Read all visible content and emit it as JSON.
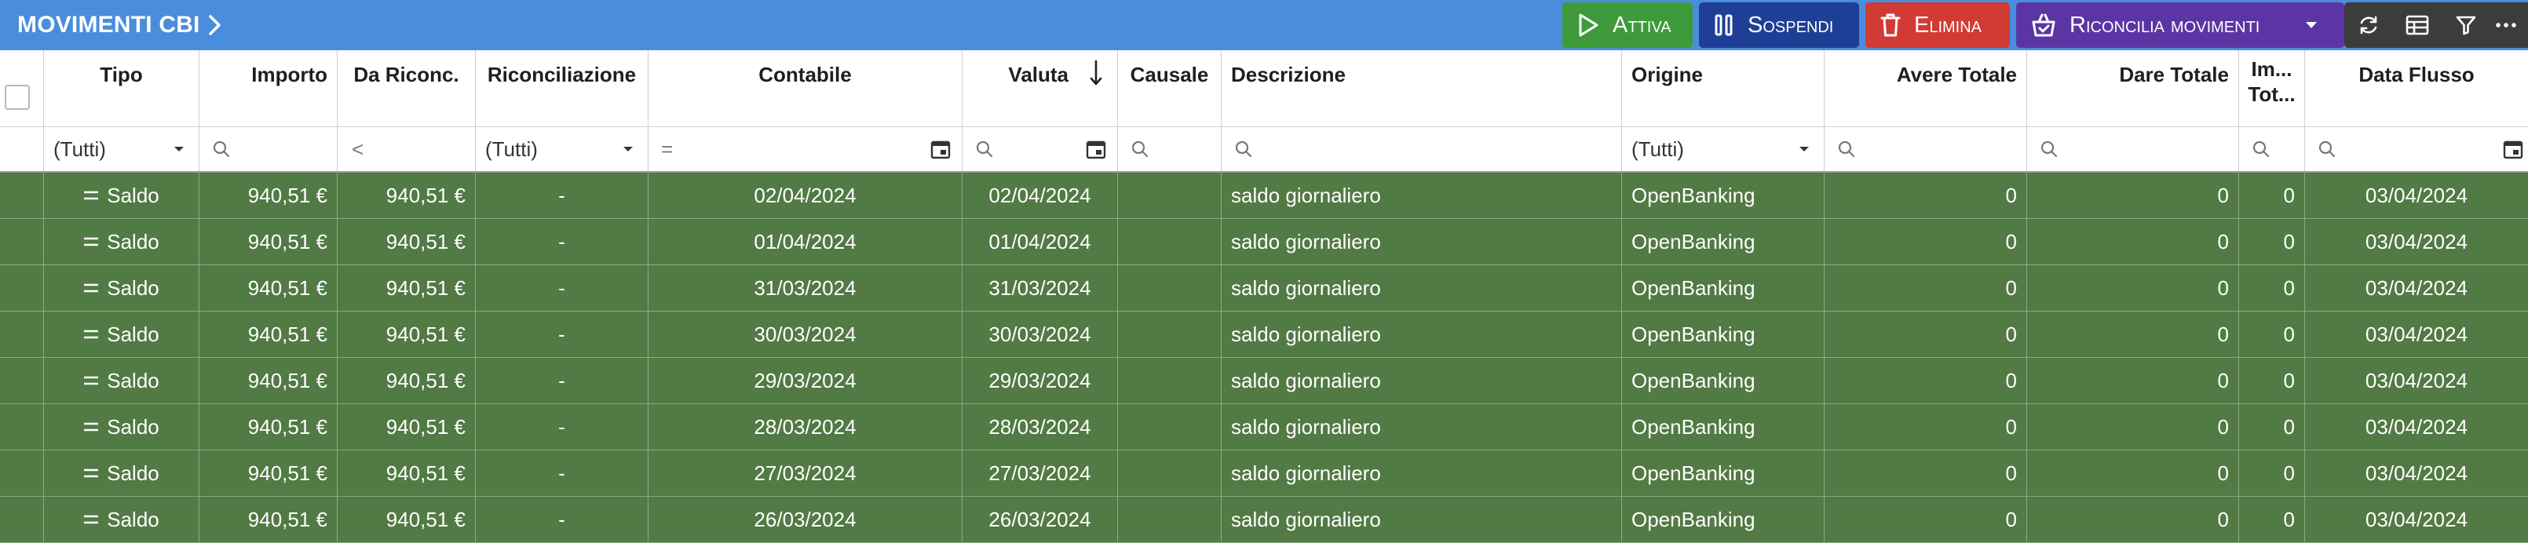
{
  "header": {
    "title": "MOVIMENTI CBI",
    "actions": {
      "attiva": "Attiva",
      "sospendi": "Sospendi",
      "elimina": "Elimina",
      "riconcilia": "Riconcilia movimenti"
    },
    "icons": [
      "play-icon",
      "pause-icon",
      "trash-icon",
      "basket-icon",
      "refresh-icon",
      "grid-icon",
      "filter-icon",
      "more-icon"
    ]
  },
  "colors": {
    "topbar": "#4a8ddc",
    "attiva": "#3e9a3a",
    "sospendi": "#1e3f95",
    "elimina": "#d23a34",
    "riconcilia": "#5b35a3",
    "row": "#527a44"
  },
  "table": {
    "columns": {
      "tipo": "Tipo",
      "importo": "Importo",
      "da_riconc": "Da Riconc.",
      "riconciliazione": "Riconciliazione",
      "contabile": "Contabile",
      "valuta": "Valuta",
      "causale": "Causale",
      "descrizione": "Descrizione",
      "origine": "Origine",
      "avere_totale": "Avere Totale",
      "dare_totale": "Dare Totale",
      "im_tot_line1": "Im...",
      "im_tot_line2": "Tot...",
      "data_flusso": "Data Flusso"
    },
    "filters": {
      "tipo": "(Tutti)",
      "da_riconc_op": "<",
      "riconciliazione": "(Tutti)",
      "contabile_op": "=",
      "origine": "(Tutti)"
    },
    "rows": [
      {
        "tipo": "Saldo",
        "importo": "940,51 €",
        "da_riconc": "940,51 €",
        "riconciliazione": "-",
        "contabile": "02/04/2024",
        "valuta": "02/04/2024",
        "causale": "",
        "descrizione": "saldo giornaliero",
        "origine": "OpenBanking",
        "avere_totale": "0",
        "dare_totale": "0",
        "im_tot": "0",
        "data_flusso": "03/04/2024"
      },
      {
        "tipo": "Saldo",
        "importo": "940,51 €",
        "da_riconc": "940,51 €",
        "riconciliazione": "-",
        "contabile": "01/04/2024",
        "valuta": "01/04/2024",
        "causale": "",
        "descrizione": "saldo giornaliero",
        "origine": "OpenBanking",
        "avere_totale": "0",
        "dare_totale": "0",
        "im_tot": "0",
        "data_flusso": "03/04/2024"
      },
      {
        "tipo": "Saldo",
        "importo": "940,51 €",
        "da_riconc": "940,51 €",
        "riconciliazione": "-",
        "contabile": "31/03/2024",
        "valuta": "31/03/2024",
        "causale": "",
        "descrizione": "saldo giornaliero",
        "origine": "OpenBanking",
        "avere_totale": "0",
        "dare_totale": "0",
        "im_tot": "0",
        "data_flusso": "03/04/2024"
      },
      {
        "tipo": "Saldo",
        "importo": "940,51 €",
        "da_riconc": "940,51 €",
        "riconciliazione": "-",
        "contabile": "30/03/2024",
        "valuta": "30/03/2024",
        "causale": "",
        "descrizione": "saldo giornaliero",
        "origine": "OpenBanking",
        "avere_totale": "0",
        "dare_totale": "0",
        "im_tot": "0",
        "data_flusso": "03/04/2024"
      },
      {
        "tipo": "Saldo",
        "importo": "940,51 €",
        "da_riconc": "940,51 €",
        "riconciliazione": "-",
        "contabile": "29/03/2024",
        "valuta": "29/03/2024",
        "causale": "",
        "descrizione": "saldo giornaliero",
        "origine": "OpenBanking",
        "avere_totale": "0",
        "dare_totale": "0",
        "im_tot": "0",
        "data_flusso": "03/04/2024"
      },
      {
        "tipo": "Saldo",
        "importo": "940,51 €",
        "da_riconc": "940,51 €",
        "riconciliazione": "-",
        "contabile": "28/03/2024",
        "valuta": "28/03/2024",
        "causale": "",
        "descrizione": "saldo giornaliero",
        "origine": "OpenBanking",
        "avere_totale": "0",
        "dare_totale": "0",
        "im_tot": "0",
        "data_flusso": "03/04/2024"
      },
      {
        "tipo": "Saldo",
        "importo": "940,51 €",
        "da_riconc": "940,51 €",
        "riconciliazione": "-",
        "contabile": "27/03/2024",
        "valuta": "27/03/2024",
        "causale": "",
        "descrizione": "saldo giornaliero",
        "origine": "OpenBanking",
        "avere_totale": "0",
        "dare_totale": "0",
        "im_tot": "0",
        "data_flusso": "03/04/2024"
      },
      {
        "tipo": "Saldo",
        "importo": "940,51 €",
        "da_riconc": "940,51 €",
        "riconciliazione": "-",
        "contabile": "26/03/2024",
        "valuta": "26/03/2024",
        "causale": "",
        "descrizione": "saldo giornaliero",
        "origine": "OpenBanking",
        "avere_totale": "0",
        "dare_totale": "0",
        "im_tot": "0",
        "data_flusso": "03/04/2024"
      }
    ]
  }
}
